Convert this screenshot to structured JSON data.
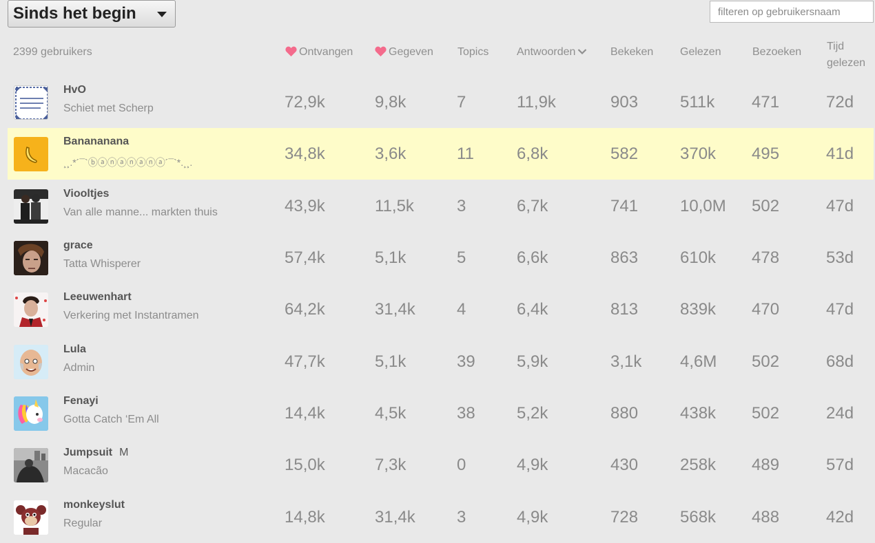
{
  "period_select": {
    "label": "Sinds het begin"
  },
  "filter": {
    "placeholder": "filteren op gebruikersnaam"
  },
  "header": {
    "user_count": "2399 gebruikers",
    "received": "Ontvangen",
    "given": "Gegeven",
    "topics": "Topics",
    "replies": "Antwoorden",
    "viewed": "Bekeken",
    "read": "Gelezen",
    "visits": "Bezoeken",
    "time_read_line1": "Tijd",
    "time_read_line2": "gelezen"
  },
  "colors": {
    "heart": "#f46b8c",
    "highlight_row": "#fefcc9",
    "background": "#e9e9e9"
  },
  "rows": [
    {
      "username": "HvO",
      "badge": "",
      "title": "Schiet met Scherp",
      "avatar": "tile-avatar",
      "received": "72,9k",
      "given": "9,8k",
      "topics": "7",
      "replies": "11,9k",
      "viewed": "903",
      "read": "511k",
      "visits": "471",
      "time_read": "72d"
    },
    {
      "username": "Banananana",
      "badge": "",
      "title": "¸¸.*´¯`ⓑⓐⓝⓐⓝⓐⓝⓐ´¯`*.¸¸.",
      "avatar": "banana-avatar",
      "received": "34,8k",
      "given": "3,6k",
      "topics": "11",
      "replies": "6,8k",
      "viewed": "582",
      "read": "370k",
      "visits": "495",
      "time_read": "41d"
    },
    {
      "username": "Viooltjes",
      "badge": "",
      "title": "Van alle manne... markten thuis",
      "avatar": "couple-avatar",
      "received": "43,9k",
      "given": "11,5k",
      "topics": "3",
      "replies": "6,7k",
      "viewed": "741",
      "read": "10,0M",
      "visits": "502",
      "time_read": "47d"
    },
    {
      "username": "grace",
      "badge": "",
      "title": "Tatta Whisperer",
      "avatar": "face-avatar",
      "received": "57,4k",
      "given": "5,1k",
      "topics": "5",
      "replies": "6,6k",
      "viewed": "863",
      "read": "610k",
      "visits": "478",
      "time_read": "53d"
    },
    {
      "username": "Leeuwenhart",
      "badge": "",
      "title": "Verkering met Instantramen",
      "avatar": "man-avatar",
      "received": "64,2k",
      "given": "31,4k",
      "topics": "4",
      "replies": "6,4k",
      "viewed": "813",
      "read": "839k",
      "visits": "470",
      "time_read": "47d"
    },
    {
      "username": "Lula",
      "badge": "",
      "title": "Admin",
      "avatar": "bald-man-avatar",
      "received": "47,7k",
      "given": "5,1k",
      "topics": "39",
      "replies": "5,9k",
      "viewed": "3,1k",
      "read": "4,6M",
      "visits": "502",
      "time_read": "68d"
    },
    {
      "username": "Fenayi",
      "badge": "",
      "title": "Gotta Catch ‘Em All",
      "avatar": "unicorn-avatar",
      "received": "14,4k",
      "given": "4,5k",
      "topics": "38",
      "replies": "5,2k",
      "viewed": "880",
      "read": "438k",
      "visits": "502",
      "time_read": "24d"
    },
    {
      "username": "Jumpsuit",
      "badge": "M",
      "title": "Macacão",
      "avatar": "bw-photo-avatar",
      "received": "15,0k",
      "given": "7,3k",
      "topics": "0",
      "replies": "4,9k",
      "viewed": "430",
      "read": "258k",
      "visits": "489",
      "time_read": "57d"
    },
    {
      "username": "monkeyslut",
      "badge": "",
      "title": "Regular",
      "avatar": "monkey-avatar",
      "received": "14,8k",
      "given": "31,4k",
      "topics": "3",
      "replies": "4,9k",
      "viewed": "728",
      "read": "568k",
      "visits": "488",
      "time_read": "42d"
    }
  ]
}
